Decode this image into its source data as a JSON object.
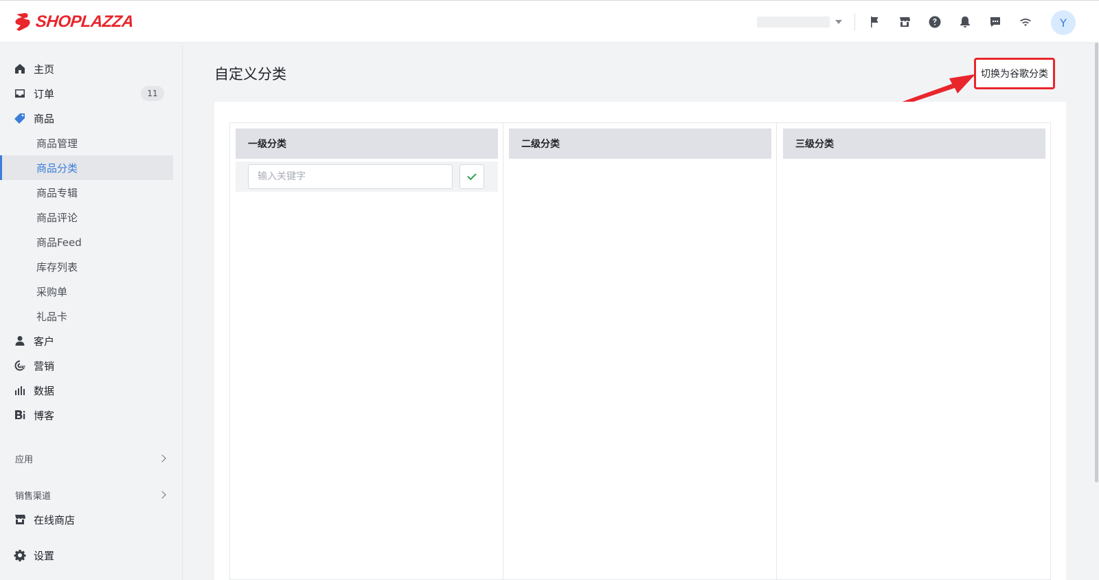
{
  "brand": {
    "name": "SHOPLAZZA",
    "color": "#e8262c"
  },
  "topbar": {
    "icons": [
      "flag-icon",
      "store-icon",
      "help-icon",
      "bell-icon",
      "message-icon",
      "wifi-icon"
    ],
    "avatar_initial": "Y"
  },
  "sidebar": {
    "home": "主页",
    "orders": {
      "label": "订单",
      "badge": "11"
    },
    "products": {
      "label": "商品",
      "children": [
        "商品管理",
        "商品分类",
        "商品专辑",
        "商品评论",
        "商品Feed",
        "库存列表",
        "采购单",
        "礼品卡"
      ],
      "active": "商品分类"
    },
    "customers": "客户",
    "marketing": "营销",
    "analytics": "数据",
    "blog": "博客",
    "apps_section": "应用",
    "channels_section": "销售渠道",
    "online_store": "在线商店",
    "settings": "设置",
    "accent": "#3b7ed8"
  },
  "main": {
    "title": "自定义分类",
    "switch_button": "切换为谷歌分类",
    "columns": [
      {
        "title": "一级分类"
      },
      {
        "title": "二级分类"
      },
      {
        "title": "三级分类"
      }
    ],
    "search": {
      "placeholder": "输入关键字"
    }
  }
}
